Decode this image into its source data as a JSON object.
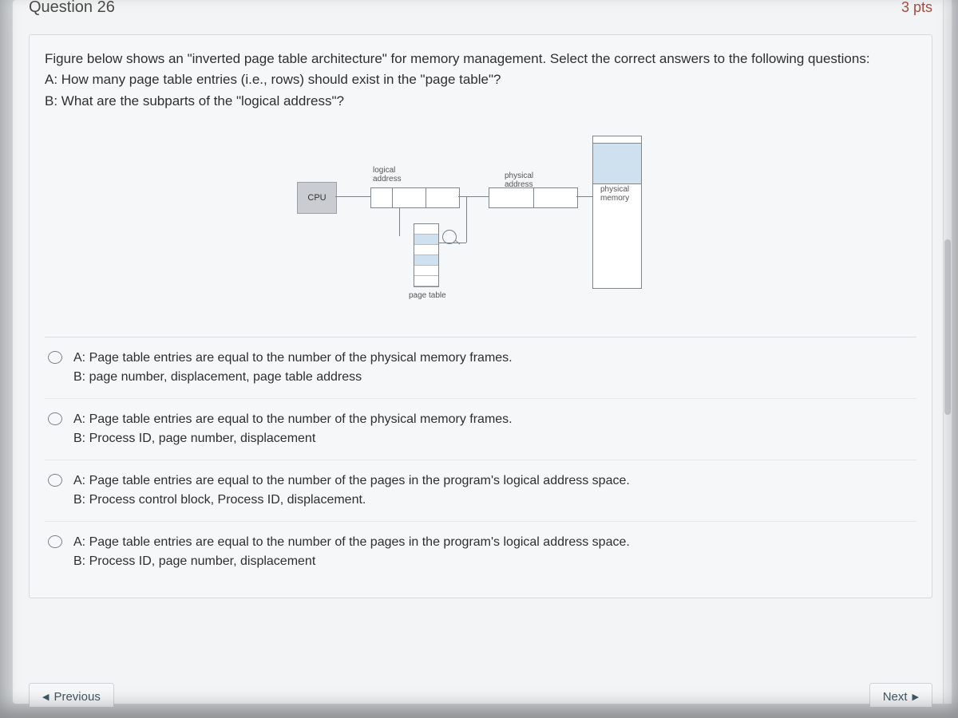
{
  "header": {
    "title": "Question 26",
    "points": "3 pts"
  },
  "prompt": {
    "intro": "Figure below shows an \"inverted page table architecture\" for memory management. Select the correct answers to the following questions:",
    "qa": "A:  How many page table entries (i.e., rows) should exist in the \"page table\"?",
    "qb": "B: What are the subparts of the \"logical address\"?"
  },
  "figure": {
    "cpu": "CPU",
    "logical_label": "logical\naddress",
    "physical_label": "physical\naddress",
    "pm_label": "physical\nmemory",
    "pt_label": "page table"
  },
  "answers": [
    {
      "a": "A: Page table entries are equal to the number of the physical memory frames.",
      "b": "B:   page number, displacement, page table address"
    },
    {
      "a": "A: Page table entries are equal to the number of the physical memory frames.",
      "b": "B:   Process ID, page number, displacement"
    },
    {
      "a": "A: Page table entries are equal to the number of the pages in the program's logical address space.",
      "b": "B:  Process control block, Process ID, displacement."
    },
    {
      "a": "A: Page table entries are equal to the number of the pages in the program's logical address space.",
      "b": "B:  Process ID, page number, displacement"
    }
  ],
  "nav": {
    "prev": "Previous",
    "next": "Next"
  }
}
